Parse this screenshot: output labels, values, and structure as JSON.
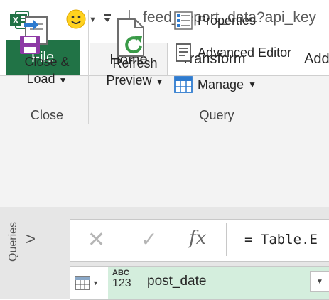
{
  "window": {
    "title": "feed_report_data?api_key"
  },
  "qat": {
    "excel_icon": "excel-icon",
    "smiley_icon": "smiley-feedback-icon",
    "customize_icon": "qat-customize-icon"
  },
  "tabs": [
    {
      "label": "File"
    },
    {
      "label": "Home"
    },
    {
      "label": "Transform"
    },
    {
      "label": "Add"
    }
  ],
  "ribbon": {
    "close_group": {
      "close_load_line1": "Close &",
      "close_load_line2": "Load",
      "label": "Close"
    },
    "query_group": {
      "refresh_line1": "Refresh",
      "refresh_line2": "Preview",
      "properties": "Properties",
      "advanced_editor": "Advanced Editor",
      "manage": "Manage",
      "label": "Query"
    }
  },
  "queries_pane": {
    "label": "Queries",
    "expand_glyph": ">"
  },
  "formula_bar": {
    "cancel_glyph": "✕",
    "confirm_glyph": "✓",
    "fx": "fx",
    "value": "= Table.E"
  },
  "grid": {
    "type_top": "ABC",
    "type_bottom": "123",
    "column_name": "post_date"
  },
  "colors": {
    "accent": "#217346",
    "ribbon_bg": "#f3f3f3",
    "selected_column": "#d4eedd"
  }
}
